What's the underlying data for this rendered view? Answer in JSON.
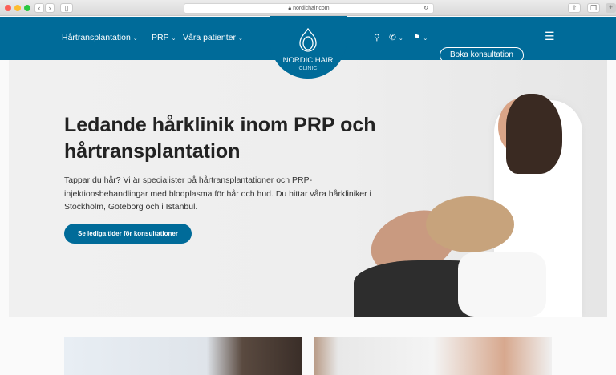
{
  "browser": {
    "url": "nordichair.com"
  },
  "nav": {
    "items": [
      {
        "label": "Hårtransplantation"
      },
      {
        "label": "PRP"
      },
      {
        "label": "Våra patienter"
      }
    ],
    "book_label": "Boka konsultation",
    "logo_line1": "NORDIC HAIR",
    "logo_line2": "CLINIC"
  },
  "hero": {
    "title": "Ledande hårklinik inom PRP och hårtransplantation",
    "lead": "Tappar du hår? Vi är specialister på hårtransplantationer och PRP-injektionsbehandlingar med blodplasma för hår och hud. Du hittar våra hårkliniker i Stockholm, Göteborg och i Istanbul.",
    "cta": "Se lediga tider för konsultationer"
  },
  "colors": {
    "brand": "#006b99"
  }
}
